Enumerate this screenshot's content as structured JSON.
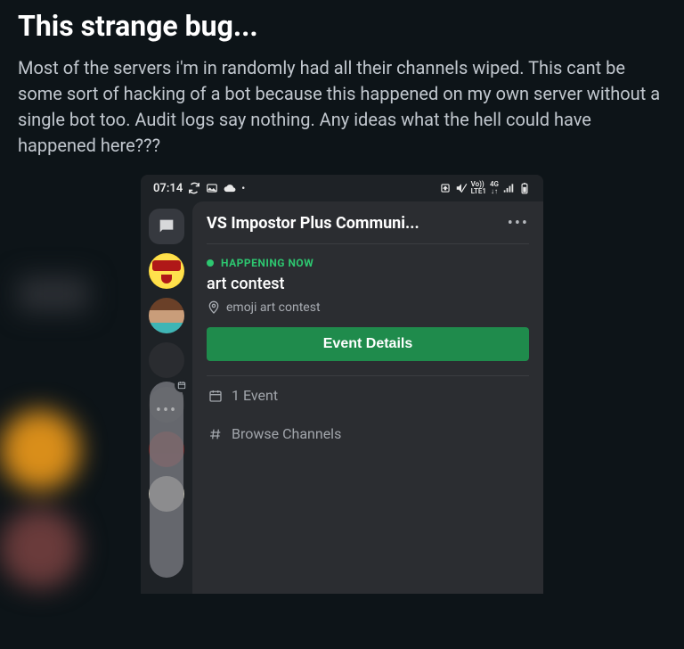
{
  "post": {
    "title": "This strange bug...",
    "body": "Most of the servers i'm in randomly had all their channels wiped. This cant be some sort of hacking of a bot because this happened on my own server without a single bot too. Audit logs say nothing. Any ideas what the hell could have happened here???"
  },
  "phone": {
    "statusbar": {
      "time": "07:14",
      "net_label_top": "Vo))",
      "net_label_bot": "LTE1",
      "net_gen": "4G"
    },
    "server_name": "VS Impostor Plus Communi...",
    "event": {
      "status": "HAPPENING NOW",
      "title": "art contest",
      "location": "emoji art contest",
      "button": "Event Details"
    },
    "items": {
      "events": "1 Event",
      "browse": "Browse Channels"
    }
  }
}
